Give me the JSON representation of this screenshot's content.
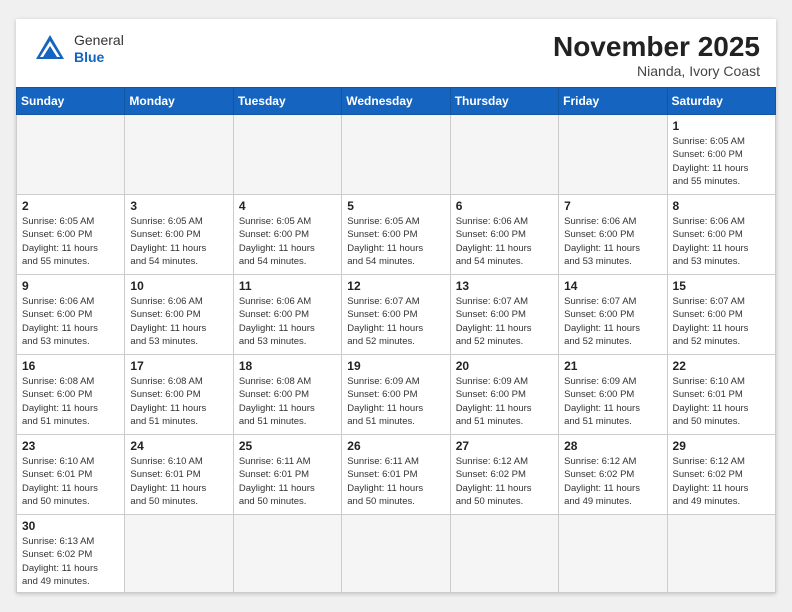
{
  "header": {
    "logo_general": "General",
    "logo_blue": "Blue",
    "month": "November 2025",
    "location": "Nianda, Ivory Coast"
  },
  "weekdays": [
    "Sunday",
    "Monday",
    "Tuesday",
    "Wednesday",
    "Thursday",
    "Friday",
    "Saturday"
  ],
  "weeks": [
    [
      {
        "day": "",
        "info": ""
      },
      {
        "day": "",
        "info": ""
      },
      {
        "day": "",
        "info": ""
      },
      {
        "day": "",
        "info": ""
      },
      {
        "day": "",
        "info": ""
      },
      {
        "day": "",
        "info": ""
      },
      {
        "day": "1",
        "info": "Sunrise: 6:05 AM\nSunset: 6:00 PM\nDaylight: 11 hours\nand 55 minutes."
      }
    ],
    [
      {
        "day": "2",
        "info": "Sunrise: 6:05 AM\nSunset: 6:00 PM\nDaylight: 11 hours\nand 55 minutes."
      },
      {
        "day": "3",
        "info": "Sunrise: 6:05 AM\nSunset: 6:00 PM\nDaylight: 11 hours\nand 54 minutes."
      },
      {
        "day": "4",
        "info": "Sunrise: 6:05 AM\nSunset: 6:00 PM\nDaylight: 11 hours\nand 54 minutes."
      },
      {
        "day": "5",
        "info": "Sunrise: 6:05 AM\nSunset: 6:00 PM\nDaylight: 11 hours\nand 54 minutes."
      },
      {
        "day": "6",
        "info": "Sunrise: 6:06 AM\nSunset: 6:00 PM\nDaylight: 11 hours\nand 54 minutes."
      },
      {
        "day": "7",
        "info": "Sunrise: 6:06 AM\nSunset: 6:00 PM\nDaylight: 11 hours\nand 53 minutes."
      },
      {
        "day": "8",
        "info": "Sunrise: 6:06 AM\nSunset: 6:00 PM\nDaylight: 11 hours\nand 53 minutes."
      }
    ],
    [
      {
        "day": "9",
        "info": "Sunrise: 6:06 AM\nSunset: 6:00 PM\nDaylight: 11 hours\nand 53 minutes."
      },
      {
        "day": "10",
        "info": "Sunrise: 6:06 AM\nSunset: 6:00 PM\nDaylight: 11 hours\nand 53 minutes."
      },
      {
        "day": "11",
        "info": "Sunrise: 6:06 AM\nSunset: 6:00 PM\nDaylight: 11 hours\nand 53 minutes."
      },
      {
        "day": "12",
        "info": "Sunrise: 6:07 AM\nSunset: 6:00 PM\nDaylight: 11 hours\nand 52 minutes."
      },
      {
        "day": "13",
        "info": "Sunrise: 6:07 AM\nSunset: 6:00 PM\nDaylight: 11 hours\nand 52 minutes."
      },
      {
        "day": "14",
        "info": "Sunrise: 6:07 AM\nSunset: 6:00 PM\nDaylight: 11 hours\nand 52 minutes."
      },
      {
        "day": "15",
        "info": "Sunrise: 6:07 AM\nSunset: 6:00 PM\nDaylight: 11 hours\nand 52 minutes."
      }
    ],
    [
      {
        "day": "16",
        "info": "Sunrise: 6:08 AM\nSunset: 6:00 PM\nDaylight: 11 hours\nand 51 minutes."
      },
      {
        "day": "17",
        "info": "Sunrise: 6:08 AM\nSunset: 6:00 PM\nDaylight: 11 hours\nand 51 minutes."
      },
      {
        "day": "18",
        "info": "Sunrise: 6:08 AM\nSunset: 6:00 PM\nDaylight: 11 hours\nand 51 minutes."
      },
      {
        "day": "19",
        "info": "Sunrise: 6:09 AM\nSunset: 6:00 PM\nDaylight: 11 hours\nand 51 minutes."
      },
      {
        "day": "20",
        "info": "Sunrise: 6:09 AM\nSunset: 6:00 PM\nDaylight: 11 hours\nand 51 minutes."
      },
      {
        "day": "21",
        "info": "Sunrise: 6:09 AM\nSunset: 6:00 PM\nDaylight: 11 hours\nand 51 minutes."
      },
      {
        "day": "22",
        "info": "Sunrise: 6:10 AM\nSunset: 6:01 PM\nDaylight: 11 hours\nand 50 minutes."
      }
    ],
    [
      {
        "day": "23",
        "info": "Sunrise: 6:10 AM\nSunset: 6:01 PM\nDaylight: 11 hours\nand 50 minutes."
      },
      {
        "day": "24",
        "info": "Sunrise: 6:10 AM\nSunset: 6:01 PM\nDaylight: 11 hours\nand 50 minutes."
      },
      {
        "day": "25",
        "info": "Sunrise: 6:11 AM\nSunset: 6:01 PM\nDaylight: 11 hours\nand 50 minutes."
      },
      {
        "day": "26",
        "info": "Sunrise: 6:11 AM\nSunset: 6:01 PM\nDaylight: 11 hours\nand 50 minutes."
      },
      {
        "day": "27",
        "info": "Sunrise: 6:12 AM\nSunset: 6:02 PM\nDaylight: 11 hours\nand 50 minutes."
      },
      {
        "day": "28",
        "info": "Sunrise: 6:12 AM\nSunset: 6:02 PM\nDaylight: 11 hours\nand 49 minutes."
      },
      {
        "day": "29",
        "info": "Sunrise: 6:12 AM\nSunset: 6:02 PM\nDaylight: 11 hours\nand 49 minutes."
      }
    ],
    [
      {
        "day": "30",
        "info": "Sunrise: 6:13 AM\nSunset: 6:02 PM\nDaylight: 11 hours\nand 49 minutes."
      },
      {
        "day": "",
        "info": ""
      },
      {
        "day": "",
        "info": ""
      },
      {
        "day": "",
        "info": ""
      },
      {
        "day": "",
        "info": ""
      },
      {
        "day": "",
        "info": ""
      },
      {
        "day": "",
        "info": ""
      }
    ]
  ]
}
